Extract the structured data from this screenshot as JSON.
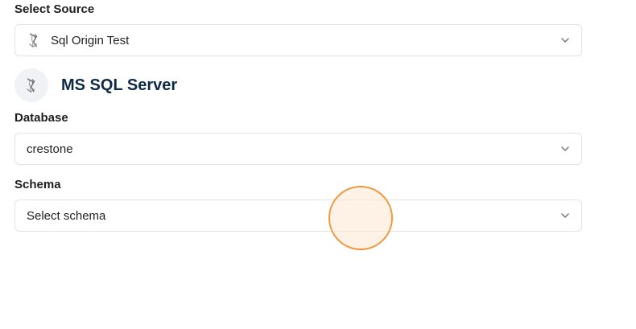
{
  "source": {
    "label": "Select Source",
    "selected": "Sql Origin Test",
    "icon": "ms-sql-server-logo-icon"
  },
  "connector": {
    "title": "MS SQL Server",
    "icon": "ms-sql-server-logo-icon"
  },
  "database": {
    "label": "Database",
    "selected": "crestone"
  },
  "schema": {
    "label": "Schema",
    "placeholder": "Select schema"
  },
  "colors": {
    "title": "#0e2a47",
    "border": "#e3e3e6",
    "click_indicator": "#f2963a"
  }
}
